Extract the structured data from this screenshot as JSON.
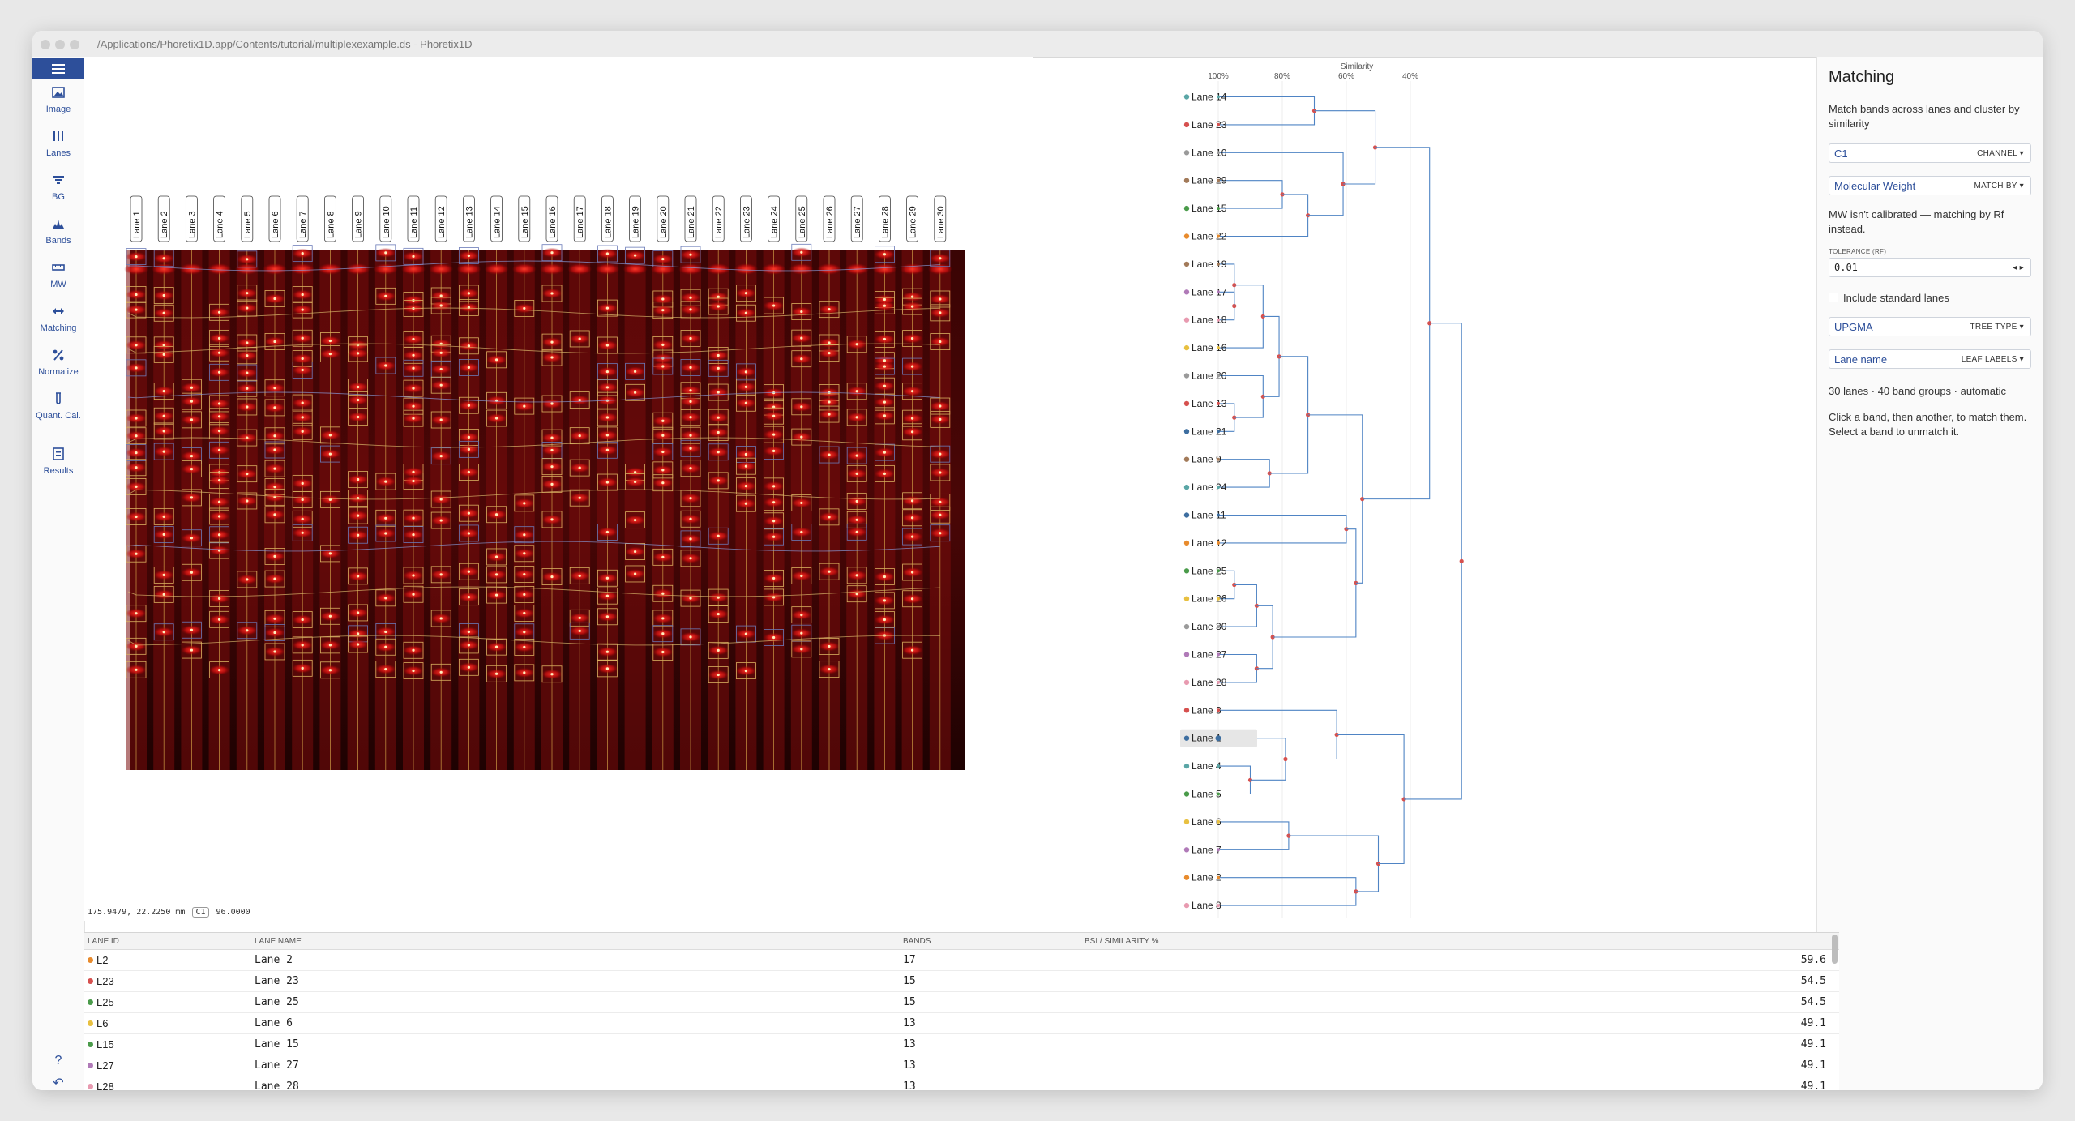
{
  "window": {
    "title": "/Applications/Phoretix1D.app/Contents/tutorial/multiplexexample.ds - Phoretix1D"
  },
  "toolbar": {
    "menu_icon": "hamburger-menu-icon",
    "items": [
      {
        "label": "Image",
        "icon": "image-icon"
      },
      {
        "label": "Lanes",
        "icon": "lanes-icon"
      },
      {
        "label": "BG",
        "icon": "filter-icon"
      },
      {
        "label": "Bands",
        "icon": "bands-icon"
      },
      {
        "label": "MW",
        "icon": "ruler-icon"
      },
      {
        "label": "Matching",
        "icon": "matching-arrows-icon",
        "active": true
      },
      {
        "label": "Normalize",
        "icon": "percent-icon"
      },
      {
        "label": "Quant. Cal.",
        "icon": "tube-icon"
      },
      {
        "label": "Results",
        "icon": "results-icon"
      }
    ],
    "bottom_icons": [
      "help-icon",
      "undo-icon",
      "redo-icon"
    ]
  },
  "gel": {
    "lane_labels": [
      "Lane 1",
      "Lane 2",
      "Lane 3",
      "Lane 4",
      "Lane 5",
      "Lane 6",
      "Lane 7",
      "Lane 8",
      "Lane 9",
      "Lane 10",
      "Lane 11",
      "Lane 12",
      "Lane 13",
      "Lane 14",
      "Lane 15",
      "Lane 16",
      "Lane 17",
      "Lane 18",
      "Lane 19",
      "Lane 20",
      "Lane 21",
      "Lane 22",
      "Lane 23",
      "Lane 24",
      "Lane 25",
      "Lane 26",
      "Lane 27",
      "Lane 28",
      "Lane 29",
      "Lane 30"
    ],
    "status": {
      "coords": "175.9479, 22.2250 mm",
      "channel": "C1",
      "value": "96.0000"
    }
  },
  "dendrogram": {
    "axis_title": "Similarity",
    "ticks": [
      "100%",
      "80%",
      "60%",
      "40%"
    ],
    "selected_leaf": "Lane 1",
    "leaves": [
      {
        "label": "Lane 14",
        "color": "#5aa6a6"
      },
      {
        "label": "Lane 23",
        "color": "#d6504e"
      },
      {
        "label": "Lane 10",
        "color": "#9a9a9a"
      },
      {
        "label": "Lane 29",
        "color": "#a27a59"
      },
      {
        "label": "Lane 15",
        "color": "#4a9b4a"
      },
      {
        "label": "Lane 22",
        "color": "#e88b2d"
      },
      {
        "label": "Lane 19",
        "color": "#a27a59"
      },
      {
        "label": "Lane 17",
        "color": "#b07ab8"
      },
      {
        "label": "Lane 18",
        "color": "#e89ab0"
      },
      {
        "label": "Lane 16",
        "color": "#e8c040"
      },
      {
        "label": "Lane 20",
        "color": "#9a9a9a"
      },
      {
        "label": "Lane 13",
        "color": "#d6504e"
      },
      {
        "label": "Lane 21",
        "color": "#3d6ea0"
      },
      {
        "label": "Lane 9",
        "color": "#a27a59"
      },
      {
        "label": "Lane 24",
        "color": "#5aa6a6"
      },
      {
        "label": "Lane 11",
        "color": "#3d6ea0"
      },
      {
        "label": "Lane 12",
        "color": "#e88b2d"
      },
      {
        "label": "Lane 25",
        "color": "#4a9b4a"
      },
      {
        "label": "Lane 26",
        "color": "#e8c040"
      },
      {
        "label": "Lane 30",
        "color": "#9a9a9a"
      },
      {
        "label": "Lane 27",
        "color": "#b07ab8"
      },
      {
        "label": "Lane 28",
        "color": "#e89ab0"
      },
      {
        "label": "Lane 3",
        "color": "#d6504e"
      },
      {
        "label": "Lane 1",
        "color": "#3d6ea0"
      },
      {
        "label": "Lane 4",
        "color": "#5aa6a6"
      },
      {
        "label": "Lane 5",
        "color": "#4a9b4a"
      },
      {
        "label": "Lane 6",
        "color": "#e8c040"
      },
      {
        "label": "Lane 7",
        "color": "#b07ab8"
      },
      {
        "label": "Lane 2",
        "color": "#e88b2d"
      },
      {
        "label": "Lane 8",
        "color": "#e89ab0"
      }
    ]
  },
  "panel": {
    "title": "Matching",
    "description": "Match bands across lanes and cluster by similarity",
    "channel": {
      "value": "C1",
      "tag": "CHANNEL ▾"
    },
    "match_by": {
      "value": "Molecular Weight",
      "tag": "MATCH BY ▾"
    },
    "mw_note": "MW isn't calibrated — matching by Rf instead.",
    "tolerance": {
      "caption": "TOLERANCE (RF)",
      "value": "0.01"
    },
    "include_standard": "Include standard lanes",
    "tree_type": {
      "value": "UPGMA",
      "tag": "TREE TYPE ▾"
    },
    "leaf_labels": {
      "value": "Lane name",
      "tag": "LEAF LABELS ▾"
    },
    "summary": "30 lanes · 40 band groups · automatic",
    "help": "Click a band, then another, to match them. Select a band to unmatch it."
  },
  "table": {
    "headers": {
      "lane_id": "LANE ID",
      "lane_name": "LANE NAME",
      "bands": "BANDS",
      "bsi": "BSI / SIMILARITY %"
    },
    "rows": [
      {
        "id": "L2",
        "color": "#e88b2d",
        "name": "Lane 2",
        "bands": "17",
        "bsi": "59.6"
      },
      {
        "id": "L23",
        "color": "#d6504e",
        "name": "Lane 23",
        "bands": "15",
        "bsi": "54.5"
      },
      {
        "id": "L25",
        "color": "#4a9b4a",
        "name": "Lane 25",
        "bands": "15",
        "bsi": "54.5"
      },
      {
        "id": "L6",
        "color": "#e8c040",
        "name": "Lane 6",
        "bands": "13",
        "bsi": "49.1"
      },
      {
        "id": "L15",
        "color": "#4a9b4a",
        "name": "Lane 15",
        "bands": "13",
        "bsi": "49.1"
      },
      {
        "id": "L27",
        "color": "#b07ab8",
        "name": "Lane 27",
        "bands": "13",
        "bsi": "49.1"
      },
      {
        "id": "L28",
        "color": "#e89ab0",
        "name": "Lane 28",
        "bands": "13",
        "bsi": "49.1"
      }
    ]
  }
}
